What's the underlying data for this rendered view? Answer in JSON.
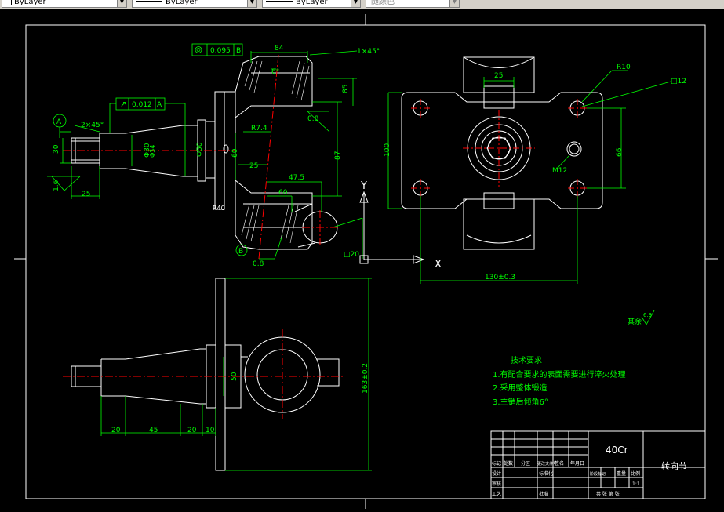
{
  "toolbar": {
    "color_combo": "ByLayer",
    "linetype_combo": "ByLayer",
    "lineweight_combo": "ByLayer",
    "plotstyle_combo": "随颜色"
  },
  "drawing": {
    "colors": {
      "outline": "#ffffff",
      "dimension": "#00ff00",
      "centerline": "#ff0000",
      "background": "#000000"
    },
    "dims": {
      "flatness": "0.095",
      "flatness_datum": "B",
      "runout": "0.012",
      "runout_datum": "A",
      "datum_a": "A",
      "datum_b": "B",
      "chamfer_shaft": "2×45°",
      "chamfer_top": "1×45°",
      "top_84": "84",
      "angle_6": "6°",
      "r74": "R7.4",
      "dim_85": "85",
      "dim_08": "0.8",
      "dim_87": "87",
      "dim_60": "60",
      "dim_475": "47.5",
      "dim_25_side": "25",
      "dim_60b": "60",
      "dim_08b": "0.8",
      "dim_30": "30",
      "dim_25_shaft": "25",
      "dim_16": "1.6",
      "phi30": "Φ30",
      "phi34": "Φ34",
      "phi50": "Φ50",
      "dim_20_box": "□20",
      "top_25": "25",
      "r10": "R10",
      "box_12": "□12",
      "dim_100": "100",
      "dim_66": "66",
      "m12": "M12",
      "dim_130": "130±0.3",
      "dim_163": "163±0.2",
      "dim_50": "50",
      "bot_20a": "20",
      "bot_45": "45",
      "bot_20b": "20",
      "bot_10": "10",
      "roughness_rest_label": "其余",
      "roughness_rest_value": "6.3",
      "axis_y": "Y",
      "axis_x": "X"
    },
    "notes": {
      "title": "技术要求",
      "items": [
        "1.有配合要求的表面需要进行淬火处理",
        "2.采用整体锻造",
        "3.主销后倾角6°"
      ]
    },
    "title_block": {
      "material": "40Cr",
      "part_name": "转向节",
      "scale": "1:1",
      "row_labels": [
        "标记",
        "处数",
        "分区",
        "更改文件号",
        "签名",
        "年月日"
      ],
      "left_labels": [
        "设计",
        "审核",
        "工艺"
      ],
      "mid_labels": [
        "标准化",
        "批准"
      ],
      "stage_labels": [
        "阶段标记",
        "重量",
        "比例"
      ],
      "bottom_labels": [
        "共 张 第 张"
      ]
    }
  }
}
